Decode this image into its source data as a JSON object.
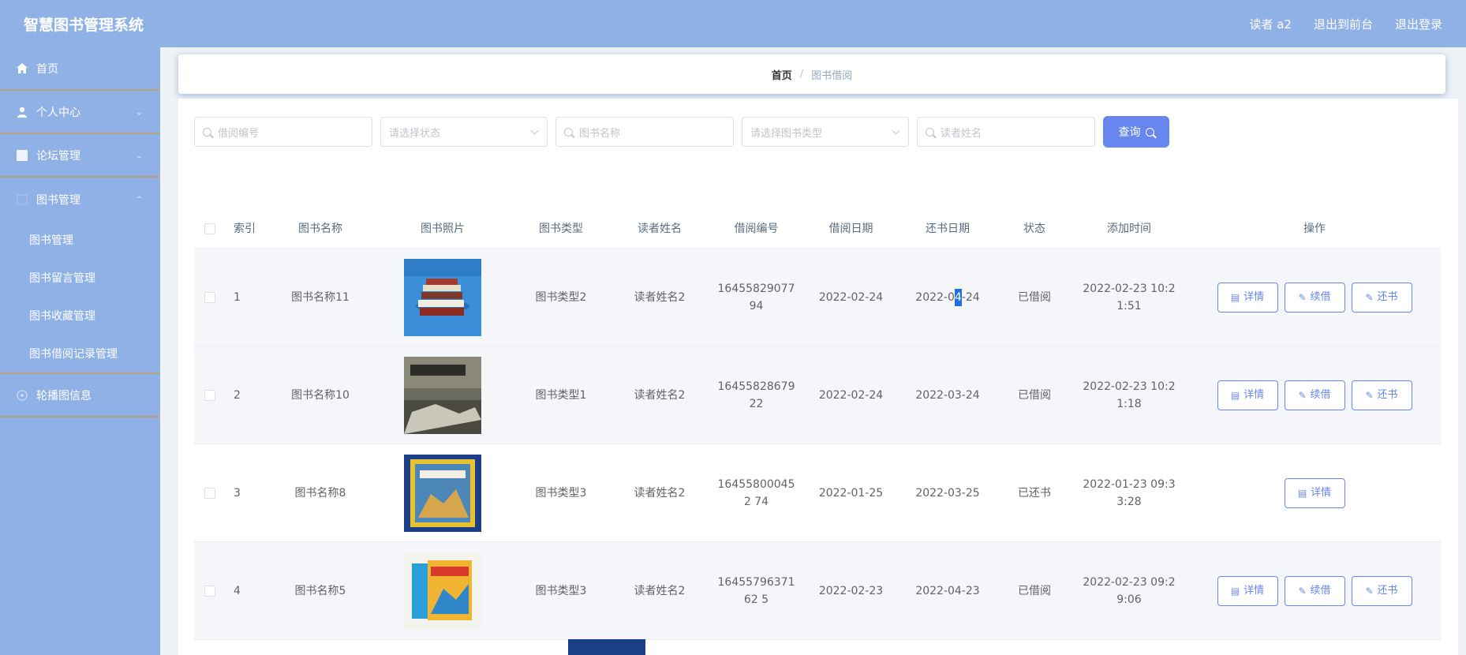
{
  "header": {
    "title": "智慧图书管理系统",
    "user": "读者 a2",
    "to_front": "退出到前台",
    "logout": "退出登录"
  },
  "sidebar": {
    "items": [
      {
        "label": "首页",
        "icon": "home-icon"
      },
      {
        "label": "个人中心",
        "icon": "user-icon"
      },
      {
        "label": "论坛管理",
        "icon": "grid-icon"
      },
      {
        "label": "图书管理",
        "icon": "book-icon"
      },
      {
        "label": "轮播图信息",
        "icon": "picture-icon"
      }
    ],
    "sub_items": [
      "图书管理",
      "图书留言管理",
      "图书收藏管理",
      "图书借阅记录管理"
    ]
  },
  "breadcrumb": {
    "home": "首页",
    "separator": "/",
    "current": "图书借阅"
  },
  "filters": {
    "borrow_no_placeholder": "借阅编号",
    "status_placeholder": "请选择状态",
    "book_name_placeholder": "图书名称",
    "book_type_placeholder": "请选择图书类型",
    "reader_name_placeholder": "读者姓名",
    "query_label": "查询"
  },
  "table": {
    "headers": {
      "index": "索引",
      "name": "图书名称",
      "picture": "图书照片",
      "type": "图书类型",
      "reader": "读者姓名",
      "borrow_no": "借阅编号",
      "borrow_date": "借阅日期",
      "return_date": "还书日期",
      "status": "状态",
      "added": "添加时间",
      "ops": "操作"
    },
    "rows": [
      {
        "index": "1",
        "name": "图书名称11",
        "type": "图书类型2",
        "reader": "读者姓名2",
        "borrow_no": "1645582907794",
        "borrow_date": "2022-02-24",
        "return_date_pre": "2022-0",
        "return_date_hl": "4",
        "return_date_post": "-24",
        "status": "已借阅",
        "added": "2022-02-23 10:21:51"
      },
      {
        "index": "2",
        "name": "图书名称10",
        "type": "图书类型1",
        "reader": "读者姓名2",
        "borrow_no": "1645582867922",
        "borrow_date": "2022-02-24",
        "return_date": "2022-03-24",
        "status": "已借阅",
        "added": "2022-02-23 10:21:18"
      },
      {
        "index": "3",
        "name": "图书名称8",
        "type": "图书类型3",
        "reader": "读者姓名2",
        "borrow_no": "164558000452 74",
        "borrow_date": "2022-01-25",
        "return_date": "2022-03-25",
        "status": "已还书",
        "added": "2022-01-23 09:33:28"
      },
      {
        "index": "4",
        "name": "图书名称5",
        "type": "图书类型3",
        "reader": "读者姓名2",
        "borrow_no": "1645579637162 5",
        "borrow_date": "2022-02-23",
        "return_date": "2022-04-23",
        "status": "已借阅",
        "added": "2022-02-23 09:29:06"
      }
    ],
    "ops": {
      "detail": "详情",
      "renew": "续借",
      "return": "还书"
    }
  },
  "colors": {
    "header": "#8fb1e6",
    "accent": "#6787ef",
    "divider": "#b9a37a"
  }
}
